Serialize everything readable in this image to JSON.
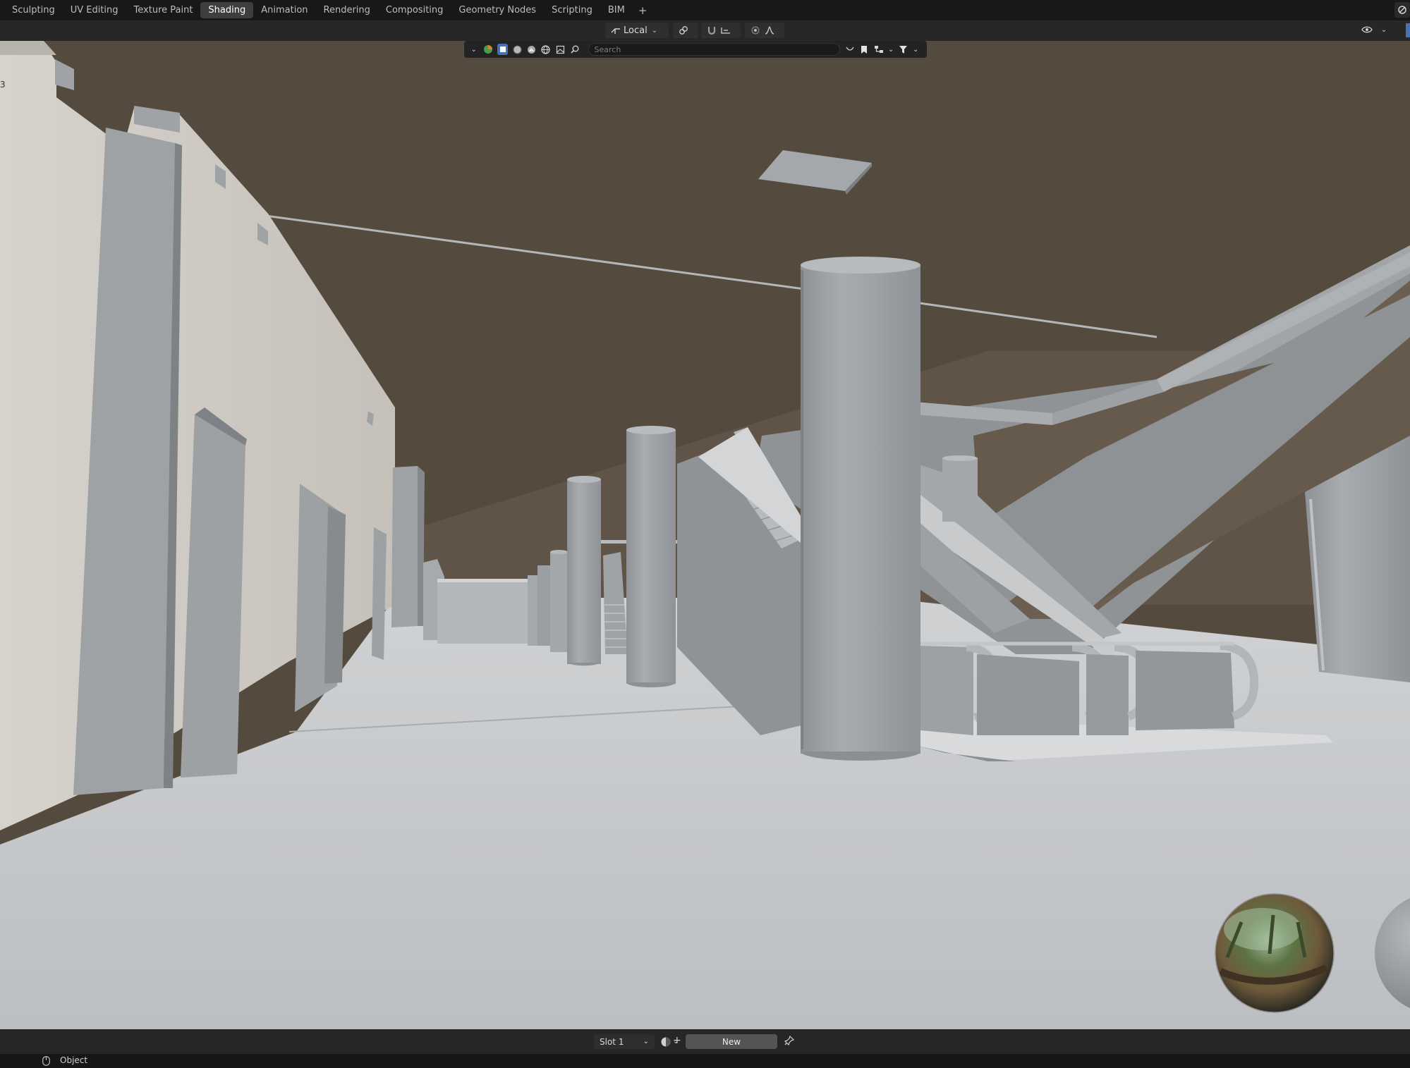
{
  "workspace_tabs": [
    {
      "label": "Sculpting"
    },
    {
      "label": "UV Editing"
    },
    {
      "label": "Texture Paint"
    },
    {
      "label": "Shading",
      "active": true
    },
    {
      "label": "Animation"
    },
    {
      "label": "Rendering"
    },
    {
      "label": "Compositing"
    },
    {
      "label": "Geometry Nodes"
    },
    {
      "label": "Scripting"
    },
    {
      "label": "BIM"
    }
  ],
  "add_workspace_label": "+",
  "viewport_header": {
    "transform_pivot": "Local"
  },
  "filter_row": {
    "search_placeholder": "Search"
  },
  "viewport": {
    "gizmo_fragment_label": "3"
  },
  "material_bar": {
    "slot": "Slot 1",
    "new_button": "New"
  },
  "status_bar": {
    "mode": "Object"
  },
  "colors": {
    "ceiling": "#554a3e",
    "floor": "#c2c4c6",
    "wall_front": "#c9c4bd",
    "pillar": "#9ea2a5",
    "ui_dark": "#181818",
    "accent": "#4772b3"
  }
}
